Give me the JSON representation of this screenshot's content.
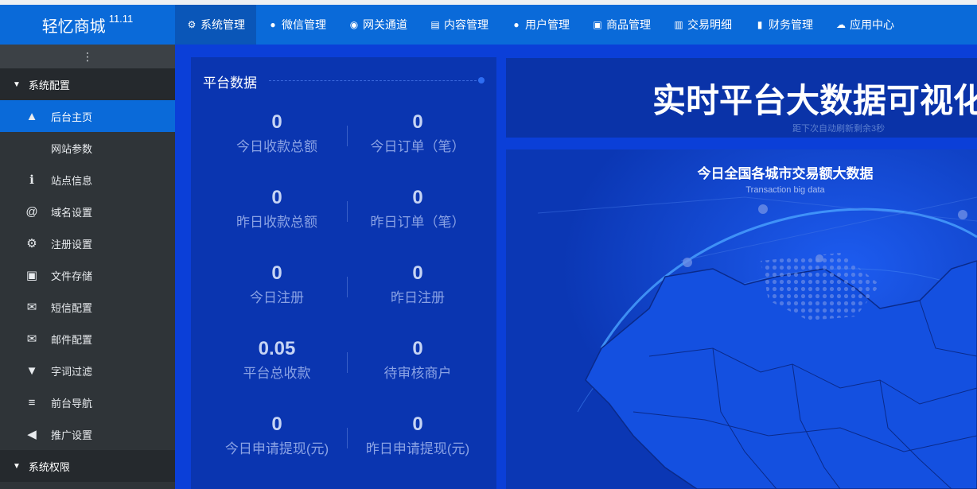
{
  "brand": {
    "name": "轻忆商城",
    "version": "11.11"
  },
  "topnav": [
    {
      "label": "系统管理",
      "icon": "gear-icon",
      "glyph": "⚙",
      "active": true
    },
    {
      "label": "微信管理",
      "icon": "wechat-icon",
      "glyph": "●"
    },
    {
      "label": "网关通道",
      "icon": "gateway-icon",
      "glyph": "◉"
    },
    {
      "label": "内容管理",
      "icon": "document-icon",
      "glyph": "▤"
    },
    {
      "label": "用户管理",
      "icon": "users-icon",
      "glyph": "●"
    },
    {
      "label": "商品管理",
      "icon": "shopping-bag-icon",
      "glyph": "▣"
    },
    {
      "label": "交易明细",
      "icon": "bar-chart-icon",
      "glyph": "▥"
    },
    {
      "label": "财务管理",
      "icon": "finance-icon",
      "glyph": "▮"
    },
    {
      "label": "应用中心",
      "icon": "cloud-icon",
      "glyph": "☁"
    }
  ],
  "sidebar": {
    "toggle_glyph": "⋮",
    "group1": "系统配置",
    "items": [
      {
        "label": "后台主页",
        "icon": "area-chart-icon",
        "glyph": "▲",
        "active": true
      },
      {
        "label": "网站参数",
        "icon": "apple-icon",
        "glyph": ""
      },
      {
        "label": "站点信息",
        "icon": "info-icon",
        "glyph": "ℹ"
      },
      {
        "label": "域名设置",
        "icon": "at-icon",
        "glyph": "@"
      },
      {
        "label": "注册设置",
        "icon": "gear-icon",
        "glyph": "⚙"
      },
      {
        "label": "文件存储",
        "icon": "save-icon",
        "glyph": "▣"
      },
      {
        "label": "短信配置",
        "icon": "envelope-icon",
        "glyph": "✉"
      },
      {
        "label": "邮件配置",
        "icon": "envelope-icon",
        "glyph": "✉"
      },
      {
        "label": "字词过滤",
        "icon": "filter-icon",
        "glyph": "▼"
      },
      {
        "label": "前台导航",
        "icon": "bars-icon",
        "glyph": "≡"
      },
      {
        "label": "推广设置",
        "icon": "megaphone-icon",
        "glyph": "◀"
      }
    ],
    "group2": "系统权限"
  },
  "platform": {
    "title": "平台数据",
    "stats": [
      [
        {
          "value": "0",
          "label": "今日收款总额"
        },
        {
          "value": "0",
          "label": "今日订单（笔）"
        }
      ],
      [
        {
          "value": "0",
          "label": "昨日收款总额"
        },
        {
          "value": "0",
          "label": "昨日订单（笔）"
        }
      ],
      [
        {
          "value": "0",
          "label": "今日注册"
        },
        {
          "value": "0",
          "label": "昨日注册"
        }
      ],
      [
        {
          "value": "0.05",
          "label": "平台总收款"
        },
        {
          "value": "0",
          "label": "待审核商户"
        }
      ],
      [
        {
          "value": "0",
          "label": "今日申请提现(元)"
        },
        {
          "value": "0",
          "label": "昨日申请提现(元)"
        }
      ]
    ]
  },
  "dashboard": {
    "title": "实时平台大数据可视化展",
    "countdown": "距下次自动刷新剩余3秒",
    "map_title": "今日全国各城市交易额大数据",
    "map_subtitle": "Transaction big data"
  },
  "colors": {
    "topbar": "#0a6ad9",
    "sidebar": "#2f3438",
    "main_bg": "#0b3fd8",
    "active": "#0a6ad9"
  }
}
